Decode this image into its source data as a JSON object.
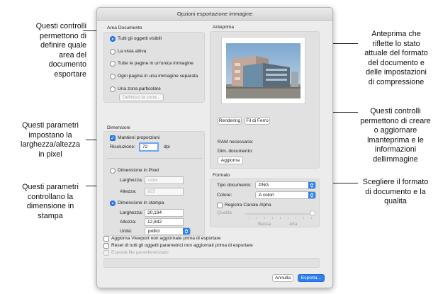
{
  "callouts": {
    "area": [
      "Questi controlli",
      "permettono di",
      "definire quale",
      "area del",
      "documento",
      "esportare"
    ],
    "size_px": [
      "Questi parametri",
      "impostano la",
      "larghezza/altezza",
      "in pixel"
    ],
    "print_size": [
      "Questi parametri",
      "controllano la",
      "dimensione in",
      "stampa"
    ],
    "preview": [
      "Anteprima che",
      "riflette lo stato",
      "attuale del formato",
      "del documento e",
      "delle impostazioni",
      "di compressione"
    ],
    "rendering": [
      "Questi controlli",
      "permettono di creare",
      "o aggiornare",
      "lmanteprima e le",
      "informazioni",
      "dellimmagine"
    ],
    "format": [
      "Scegliere il formato",
      "di documento e la",
      "qualita"
    ]
  },
  "dialog": {
    "title": "Opzioni esportazione immagine"
  },
  "area": {
    "title": "Area Documento",
    "options": [
      {
        "label": "Tutti gli oggetti visibili",
        "selected": true
      },
      {
        "label": "La vista attiva",
        "selected": false
      },
      {
        "label": "Tutte le pagine in un'unica immagine",
        "selected": false
      },
      {
        "label": "Ogni pagina in una immagine separata",
        "selected": false
      },
      {
        "label": "Una zona particolare",
        "selected": false
      }
    ],
    "define_button": "Definisci la zona..."
  },
  "dimensions": {
    "title": "Dimensioni",
    "keep_proportions": "Mantieni proporzioni",
    "resolution_label": "Risoluzione:",
    "resolution_value": "72",
    "resolution_unit": "dpi",
    "pixel_option": "Dimensione in Pixel",
    "pixel_width_label": "Larghezza:",
    "pixel_width_value": "1484",
    "pixel_height_label": "Altezza:",
    "pixel_height_value": "925",
    "print_option": "Dimensione in stampa",
    "print_width_label": "Larghezza:",
    "print_width_value": "20,194",
    "print_height_label": "Altezza:",
    "print_height_value": "12,842",
    "units_label": "Unità:",
    "units_value": "pollici"
  },
  "preview": {
    "title": "Anteprima",
    "rendering_button": "Rendering",
    "wireframe_button": "Fil di Ferro",
    "ram_label": "RAM necessaria:",
    "dim_label": "Dim. documento:",
    "update_button": "Aggiorna"
  },
  "format": {
    "title": "Formato",
    "type_label": "Tipo documento:",
    "type_value": "PNG",
    "colors_label": "Colore:",
    "colors_value": "A colori",
    "alpha_label": "Registra Canale Alpha",
    "quality_label": "Qualità",
    "quality_low": "Bassa",
    "quality_high": "Alta"
  },
  "bottom": {
    "update_viewport": "Aggiorna Viewport non aggiornate prima di esportare",
    "reset_parametric": "Reset di tutti gli oggetti parametrici non aggiornati prima di esportare",
    "georef": "Esporta file georeferenziato",
    "cancel_button": "Annulla",
    "export_button": "Esporta..."
  },
  "colors": {
    "accent": "#2f80ef",
    "dialog_bg": "#ececec"
  }
}
